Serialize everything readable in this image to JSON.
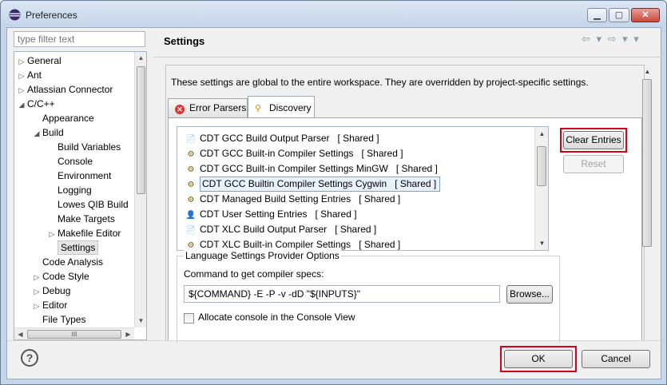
{
  "window": {
    "title": "Preferences"
  },
  "filter": {
    "placeholder": "type filter text"
  },
  "tree": {
    "items": [
      {
        "label": "General",
        "expander": "▷"
      },
      {
        "label": "Ant",
        "expander": "▷"
      },
      {
        "label": "Atlassian Connector",
        "expander": "▷"
      },
      {
        "label": "C/C++",
        "expander": "◢"
      },
      {
        "label": "Appearance",
        "expander": ""
      },
      {
        "label": "Build",
        "expander": "◢"
      },
      {
        "label": "Build Variables",
        "expander": ""
      },
      {
        "label": "Console",
        "expander": ""
      },
      {
        "label": "Environment",
        "expander": ""
      },
      {
        "label": "Logging",
        "expander": ""
      },
      {
        "label": "Lowes QIB Build",
        "expander": ""
      },
      {
        "label": "Make Targets",
        "expander": ""
      },
      {
        "label": "Makefile Editor",
        "expander": "▷"
      },
      {
        "label": "Settings",
        "expander": "",
        "selected": true
      },
      {
        "label": "Code Analysis",
        "expander": ""
      },
      {
        "label": "Code Style",
        "expander": "▷"
      },
      {
        "label": "Debug",
        "expander": "▷"
      },
      {
        "label": "Editor",
        "expander": "▷"
      },
      {
        "label": "File Types",
        "expander": ""
      }
    ],
    "hscroll_grip": "III"
  },
  "header": {
    "title": "Settings",
    "nav": "⇦ ▾ ⇨ ▾ ▾"
  },
  "description": "These settings are global to the entire workspace.  They are overridden by project-specific settings.",
  "tabs": [
    {
      "label": "Error Parsers",
      "icon": "error-icon",
      "active": false
    },
    {
      "label": "Discovery",
      "icon": "discovery-icon",
      "active": true
    }
  ],
  "providers": [
    {
      "name": "CDT GCC Build Output Parser",
      "shared": "[ Shared ]",
      "icon": "📄"
    },
    {
      "name": "CDT GCC Built-in Compiler Settings",
      "shared": "[ Shared ]",
      "icon": "⚙"
    },
    {
      "name": "CDT GCC Built-in Compiler Settings MinGW",
      "shared": "[ Shared ]",
      "icon": "⚙"
    },
    {
      "name": "CDT GCC Builtin Compiler Settings Cygwin",
      "shared": "[ Shared ]",
      "icon": "⚙",
      "selected": true
    },
    {
      "name": "CDT Managed Build Setting Entries",
      "shared": "[ Shared ]",
      "icon": "⚙"
    },
    {
      "name": "CDT User Setting Entries",
      "shared": "[ Shared ]",
      "icon": "👤"
    },
    {
      "name": "CDT XLC Build Output Parser",
      "shared": "[ Shared ]",
      "icon": "📄"
    },
    {
      "name": "CDT XLC Built-in Compiler Settings",
      "shared": "[ Shared ]",
      "icon": "⚙"
    }
  ],
  "buttons": {
    "clear_entries": "Clear Entries",
    "reset": "Reset",
    "browse": "Browse...",
    "ok": "OK",
    "cancel": "Cancel"
  },
  "options_group": {
    "title": "Language Settings Provider Options",
    "command_label": "Command to get compiler specs:",
    "command_value": "${COMMAND} -E -P -v -dD \"${INPUTS}\"",
    "allocate_console_label": "Allocate console in the Console View",
    "allocate_console_checked": false
  },
  "help": {
    "glyph": "?"
  },
  "colors": {
    "highlight": "#d6001c",
    "selection_bg": "#e8f2fc"
  }
}
